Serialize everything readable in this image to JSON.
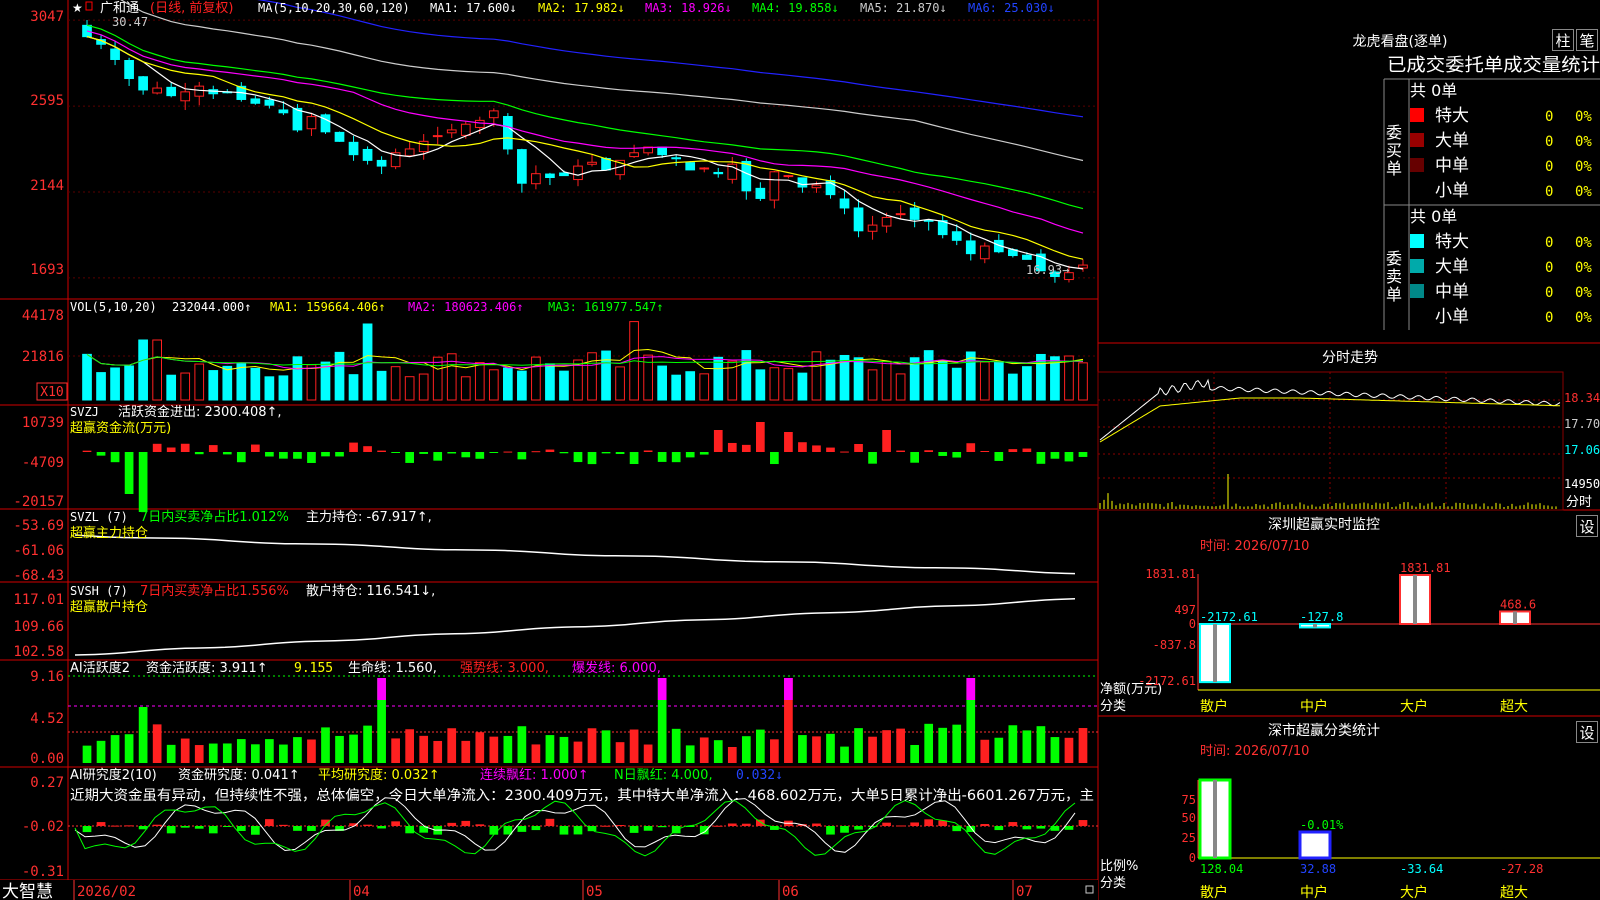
{
  "app": {
    "brand": "大智慧"
  },
  "colors": {
    "up": "#ff2020",
    "down": "#00ffff",
    "axis": "#d00000",
    "grid": "#5a0000",
    "ma1": "#ffffff",
    "ma2": "#ffff00",
    "ma3": "#ff00ff",
    "ma4": "#00ff00",
    "ma5": "#cccccc",
    "ma6": "#2222ff"
  },
  "header": {
    "stock_name": "广和通",
    "period": "(日线, 前复权)",
    "ma_label": "MA(5,10,20,30,60,120)",
    "ma1": "MA1: 17.600↓",
    "ma2": "MA2: 17.982↓",
    "ma3": "MA3: 18.926↓",
    "ma4": "MA4: 19.858↓",
    "ma5": "MA5: 21.870↓",
    "ma6": "MA6: 25.030↓",
    "high_marker": "30.47",
    "low_marker": "16.93→"
  },
  "panels": {
    "price": {
      "ticks": [
        "3047",
        "2595",
        "2144",
        "1693"
      ]
    },
    "vol": {
      "label": "VOL(5,10,20)",
      "value": "232044.000↑",
      "ma1": "MA1: 159664.406↑",
      "ma2": "MA2: 180623.406↑",
      "ma3": "MA3: 161977.547↑",
      "ticks": [
        "44178",
        "21816"
      ],
      "unit": "X10"
    },
    "svzj": {
      "label": "SVZJ",
      "title": "活跃资金进出: 2300.408↑,",
      "sub": "超赢资金流(万元)",
      "ticks": [
        "10739",
        "-4709",
        "-20157"
      ]
    },
    "svzl": {
      "label": "SVZL (7)",
      "ratio": "7日内买卖净占比1.012%",
      "holding": "主力持仓: -67.917↑,",
      "sub": "超赢主力持仓",
      "ticks": [
        "-53.69",
        "-61.06",
        "-68.43"
      ]
    },
    "svsh": {
      "label": "SVSH (7)",
      "ratio": "7日内买卖净占比1.556%",
      "holding": "散户持仓: 116.541↓,",
      "sub": "超赢散户持仓",
      "ticks": [
        "117.01",
        "109.66",
        "102.58"
      ]
    },
    "ai_active": {
      "label": "AI活跃度2",
      "val1": "资金活跃度: 3.911↑",
      "val2": "9.155",
      "val3": "生命线: 1.560,",
      "val4": "强势线: 3.000,",
      "val5": "爆发线: 6.000,",
      "ticks": [
        "9.16",
        "4.52",
        "0.00"
      ]
    },
    "ai_research": {
      "label": "AI研究度2(10)",
      "val1": "资金研究度: 0.041↑",
      "val2": "平均研究度: 0.032↑",
      "val3": "连续飘红: 1.000↑",
      "val4": "N日飘红: 4.000,",
      "val5": "0.032↓",
      "comment": "近期大资金虽有异动，但持续性不强，总体偏空，今日大单净流入：2300.409万元，其中特大单净流入：468.602万元，大单5日累计净出-6601.267万元，主",
      "ticks": [
        "0.27",
        "-0.02",
        "-0.31"
      ]
    }
  },
  "x_axis": {
    "labels": [
      "2026/02",
      "04",
      "05",
      "06",
      "07"
    ]
  },
  "right": {
    "lhb": {
      "title": "龙虎看盘(逐单)",
      "btn1": "柱",
      "btn2": "笔",
      "header": "已成交委托单成交量统计",
      "buy": {
        "label": "委买单",
        "total": "共 0单",
        "rows": [
          {
            "name": "特大",
            "count": "0",
            "pct": "0%",
            "color": "#ff0000"
          },
          {
            "name": "大单",
            "count": "0",
            "pct": "0%",
            "color": "#990000"
          },
          {
            "name": "中单",
            "count": "0",
            "pct": "0%",
            "color": "#660000"
          },
          {
            "name": "小单",
            "count": "0",
            "pct": "0%",
            "color": "#000000"
          }
        ]
      },
      "sell": {
        "label": "委卖单",
        "total": "共 0单",
        "rows": [
          {
            "name": "特大",
            "count": "0",
            "pct": "0%",
            "color": "#00ffff"
          },
          {
            "name": "大单",
            "count": "0",
            "pct": "0%",
            "color": "#00aaaa"
          },
          {
            "name": "中单",
            "count": "0",
            "pct": "0%",
            "color": "#008888"
          },
          {
            "name": "小单",
            "count": "0",
            "pct": "0%",
            "color": "#000000"
          }
        ]
      }
    },
    "intraday": {
      "title": "分时走势",
      "ticks": [
        "18.34",
        "17.70",
        "17.06"
      ],
      "vol_tick": "14950",
      "unit": "分时"
    },
    "monitor": {
      "title": "深圳超赢实时监控",
      "btn": "设",
      "date": "时间: 2026/07/10",
      "ticks": [
        "1831.81",
        "497",
        "0",
        "-837.8",
        "-2172.61"
      ],
      "yname": "净额(万元)",
      "xname": "分类",
      "cats": [
        "散户",
        "中户",
        "大户",
        "超大"
      ],
      "values": [
        "-2172.61",
        "-127.8",
        "1831.81",
        "468.6"
      ]
    },
    "classify": {
      "title": "深市超赢分类统计",
      "btn": "设",
      "date": "时间: 2026/07/10",
      "ticks": [
        "75",
        "50",
        "25",
        "0"
      ],
      "yname": "比例%",
      "xname": "分类",
      "cats": [
        "散户",
        "中户",
        "大户",
        "超大"
      ],
      "values": [
        "128.04",
        "32.88",
        "-33.64",
        "-27.28"
      ],
      "note": "-0.01%"
    }
  },
  "chart_data": [
    {
      "type": "candlestick",
      "title": "广和通 (日线, 前复权)",
      "y_ticks": [
        3047,
        2595,
        2144,
        1693
      ],
      "close_approx": [
        29.6,
        29.2,
        28.4,
        27.4,
        26.8,
        26.9,
        26.5,
        26.7,
        27.0,
        26.6,
        26.7,
        26.3,
        26.1,
        26.0,
        25.6,
        24.7,
        25.4,
        24.6,
        24.1,
        23.4,
        23.1,
        22.8,
        23.5,
        23.7,
        24.1,
        24.4,
        24.7,
        25.0,
        25.2,
        25.7,
        23.7,
        21.9,
        22.4,
        22.2,
        22.3,
        22.8,
        23.0,
        22.6,
        23.1,
        23.5,
        23.8,
        23.4,
        23.2,
        22.6,
        22.7,
        22.4,
        22.9,
        21.5,
        21.1,
        22.5,
        22.3,
        21.7,
        21.8,
        21.3,
        20.6,
        19.4,
        19.7,
        20.1,
        20.3,
        20.0,
        19.9,
        19.2,
        18.9,
        18.2,
        18.6,
        18.3,
        18.1,
        17.9,
        17.3,
        17.0,
        17.2,
        17.6
      ]
    },
    {
      "type": "bar",
      "title": "VOL(5,10,20)",
      "y_ticks": [
        44178,
        21816
      ]
    },
    {
      "type": "bar",
      "title": "SVZJ 超赢资金流(万元)",
      "y_ticks": [
        10739,
        -4709,
        -20157
      ]
    },
    {
      "type": "line",
      "title": "SVZL 超赢主力持仓",
      "y_ticks": [
        -53.69,
        -61.06,
        -68.43
      ]
    },
    {
      "type": "line",
      "title": "SVSH 超赢散户持仓",
      "y_ticks": [
        117.01,
        109.66,
        102.58
      ]
    },
    {
      "type": "bar",
      "title": "AI活跃度2",
      "y_ticks": [
        9.16,
        4.52,
        0.0
      ]
    },
    {
      "type": "bar",
      "title": "AI研究度2(10)",
      "y_ticks": [
        0.27,
        -0.02,
        -0.31
      ]
    },
    {
      "type": "bar",
      "title": "深圳超赢实时监控",
      "categories": [
        "散户",
        "中户",
        "大户",
        "超大"
      ],
      "values": [
        -2172.61,
        -127.8,
        1831.81,
        468.6
      ]
    },
    {
      "type": "bar",
      "title": "深市超赢分类统计",
      "categories": [
        "散户",
        "中户",
        "大户",
        "超大"
      ],
      "values": [
        128.04,
        32.88,
        -33.64,
        -27.28
      ]
    }
  ]
}
